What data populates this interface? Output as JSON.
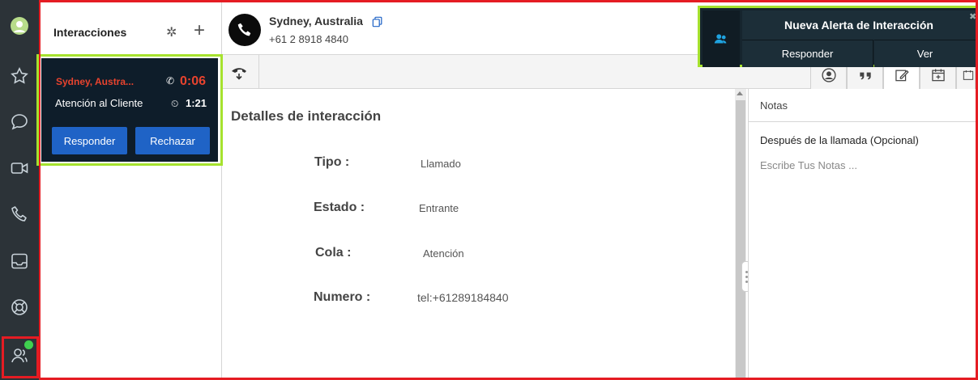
{
  "interactions": {
    "title": "Interacciones",
    "card": {
      "caller": "Sydney, Austra...",
      "timer": "0:06",
      "queue": "Atención al Cliente",
      "wait_time": "1:21",
      "accept_label": "Responder",
      "reject_label": "Rechazar"
    }
  },
  "header": {
    "caller_name": "Sydney, Australia",
    "caller_number": "+61 2 8918 4840"
  },
  "details": {
    "title": "Detalles de interacción",
    "fields": [
      {
        "label": "Tipo :",
        "value": "Llamado"
      },
      {
        "label": "Estado  :",
        "value": "Entrante"
      },
      {
        "label": "Cola  :",
        "value": "Atención"
      },
      {
        "label": "Numero   :",
        "value": "tel:+61289184840"
      }
    ]
  },
  "notes": {
    "title": "Notas",
    "subtitle": "Después de la llamada (Opcional)",
    "placeholder": "Escribe Tus Notas ..."
  },
  "alert": {
    "title": "Nueva Alerta de Interacción",
    "respond_label": "Responder",
    "view_label": "Ver"
  },
  "colors": {
    "rail": "#2c3338",
    "card": "#0e1d2a",
    "button": "#1f63c6",
    "caller_red": "#e8432e",
    "highlight_red": "#e51c23",
    "highlight_green": "#a6e22e",
    "presence": "#3fd14f"
  },
  "icons": {
    "rail": [
      "avatar-icon",
      "star-icon",
      "chat-icon",
      "video-icon",
      "phone-icon",
      "inbox-icon",
      "lifebuoy-icon",
      "agents-icon"
    ],
    "toolbar": [
      "transfer-icon",
      "contact-icon",
      "quote-icon",
      "edit-note-icon",
      "calendar-add-icon",
      "calendar-icon"
    ]
  }
}
